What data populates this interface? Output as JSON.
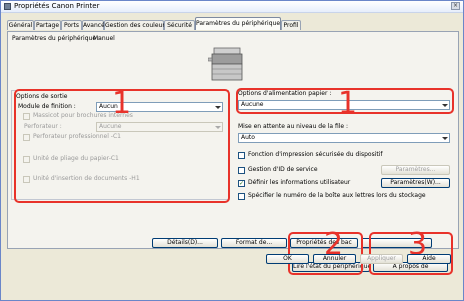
{
  "window": {
    "title": "Propriétés Canon Printer",
    "close_glyph": "×"
  },
  "tabs": [
    {
      "label": "Général"
    },
    {
      "label": "Partage"
    },
    {
      "label": "Ports"
    },
    {
      "label": "Avancé"
    },
    {
      "label": "Gestion des couleurs"
    },
    {
      "label": "Sécurité"
    },
    {
      "label": "Paramètres du périphérique"
    },
    {
      "label": "Profil"
    }
  ],
  "active_tab": "Paramètres du périphérique",
  "device_settings": {
    "label": "Paramètres du périphérique :",
    "value": "Manuel"
  },
  "output_options": {
    "title": "Options de sortie",
    "finishing_label": "Module de finition :",
    "finishing_value": "Aucun",
    "stapler_label": "Massicot pour brochures internes",
    "puncher_label": "Perforateur :",
    "puncher_value": "Aucune",
    "pro_puncher_label": "Perforateur professionnel -C1",
    "paper_folding_label": "Unité de pliage du papier-C1",
    "inserter_label": "Unité d'insertion de documents -H1"
  },
  "paper_feed": {
    "title": "Options d'alimentation papier :",
    "value": "Aucune"
  },
  "hold": {
    "label": "Mise en attente au niveau de la file :",
    "value": "Auto"
  },
  "checkboxes": {
    "secure_print": {
      "label": "Fonction d'impression sécurisée du dispositif",
      "checked": false
    },
    "dept_id": {
      "label": "Gestion d'ID de service",
      "checked": false
    },
    "user_info": {
      "label": "Définir les informations utilisateur",
      "checked": true
    },
    "mailbox": {
      "label": "Spécifier le numéro de la boîte aux lettres lors du stockage",
      "checked": false
    }
  },
  "buttons": {
    "dept_settings": "Paramètres...",
    "user_settings": "Paramètres(W)...",
    "details": "Détails(D)...",
    "paper_source": "Format de...",
    "properties": "Propriétés des bac",
    "get_device_status": "Lire l'état du périphérique",
    "about": "A propos de",
    "ok": "OK",
    "cancel": "Annuler",
    "apply": "Appliquer",
    "help": "Aide"
  },
  "callouts": [
    "1",
    "1",
    "2",
    "3"
  ],
  "colors": {
    "callout_red": "#e8322a",
    "window_border": "#6a86c9",
    "dialog_bg": "#ece9d8"
  }
}
